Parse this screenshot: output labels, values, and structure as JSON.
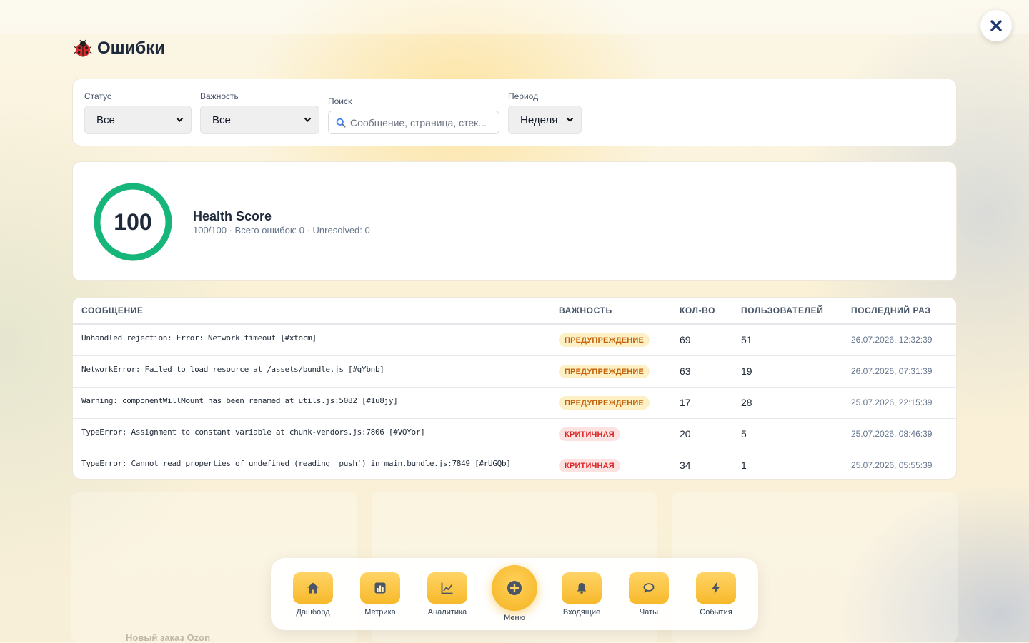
{
  "page": {
    "title": "Ошибки"
  },
  "background": {
    "footer_hint": "Новый заказ Ozon"
  },
  "filters": {
    "status": {
      "label": "Статус",
      "value": "Все"
    },
    "severity": {
      "label": "Важность",
      "value": "Все"
    },
    "search": {
      "label": "Поиск",
      "placeholder": "Сообщение, страница, стек..."
    },
    "period": {
      "label": "Период",
      "value": "Неделя"
    }
  },
  "health": {
    "score": "100",
    "score_fraction": 1.0,
    "title": "Health Score",
    "subtitle": "100/100 · Всего ошибок: 0 · Unresolved: 0",
    "color": "#16b67a"
  },
  "table": {
    "headers": {
      "message": "СООБЩЕНИЕ",
      "severity": "ВАЖНОСТЬ",
      "count": "КОЛ-ВО",
      "users": "ПОЛЬЗОВАТЕЛЕЙ",
      "last_seen": "ПОСЛЕДНИЙ РАЗ"
    },
    "rows": [
      {
        "message": "Unhandled rejection: Error: Network timeout [#xtocm]",
        "severity": "ПРЕДУПРЕЖДЕНИЕ",
        "level": "warn",
        "count": "69",
        "users": "51",
        "last_seen": "26.07.2026, 12:32:39"
      },
      {
        "message": "NetworkError: Failed to load resource at /assets/bundle.js [#gYbnb]",
        "severity": "ПРЕДУПРЕЖДЕНИЕ",
        "level": "warn",
        "count": "63",
        "users": "19",
        "last_seen": "26.07.2026, 07:31:39"
      },
      {
        "message": "Warning: componentWillMount has been renamed at utils.js:5082 [#1u8jy]",
        "severity": "ПРЕДУПРЕЖДЕНИЕ",
        "level": "warn",
        "count": "17",
        "users": "28",
        "last_seen": "25.07.2026, 22:15:39"
      },
      {
        "message": "TypeError: Assignment to constant variable at chunk-vendors.js:7806 [#VQYor]",
        "severity": "КРИТИЧНАЯ",
        "level": "crit",
        "count": "20",
        "users": "5",
        "last_seen": "25.07.2026, 08:46:39"
      },
      {
        "message": "TypeError: Cannot read properties of undefined (reading 'push') in main.bundle.js:7849 [#rUGQb]",
        "severity": "КРИТИЧНАЯ",
        "level": "crit",
        "count": "34",
        "users": "1",
        "last_seen": "25.07.2026, 05:55:39"
      }
    ]
  },
  "dock": {
    "items": [
      {
        "label": "Дашборд",
        "icon": "home-icon"
      },
      {
        "label": "Метрика",
        "icon": "bar-chart-icon"
      },
      {
        "label": "Аналитика",
        "icon": "line-chart-icon"
      },
      {
        "label": "Меню",
        "icon": "plus-circle-icon"
      },
      {
        "label": "Входящие",
        "icon": "bell-icon"
      },
      {
        "label": "Чаты",
        "icon": "chat-bubble-icon"
      },
      {
        "label": "События",
        "icon": "lightning-icon"
      }
    ]
  }
}
